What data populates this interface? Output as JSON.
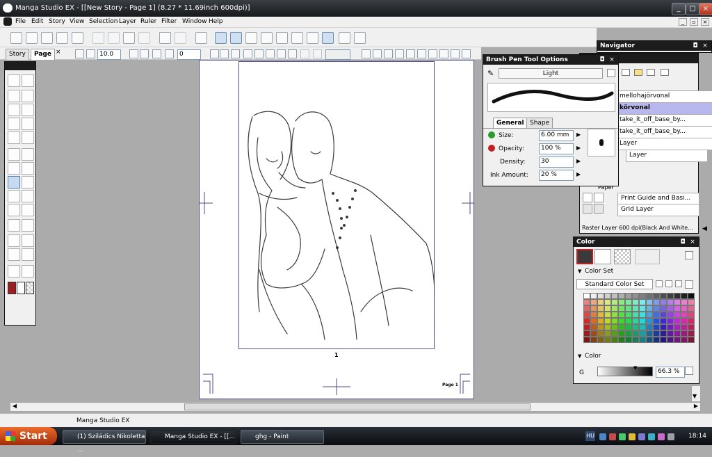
{
  "window": {
    "title": "Manga Studio EX - [[New Story - Page 1] (8.27 * 11.69inch 600dpi)]"
  },
  "menu": [
    "File",
    "Edit",
    "Story",
    "View",
    "Selection",
    "Layer",
    "Ruler",
    "Filter",
    "Window",
    "Help"
  ],
  "tabs": {
    "story": "Story",
    "page": "Page"
  },
  "toolbar2": {
    "value1": "10.0",
    "value2": "0"
  },
  "page": {
    "number": "1",
    "corner_label": "Page 1"
  },
  "navigator": {
    "title": "Navigator"
  },
  "brush": {
    "title": "Brush Pen Tool Options",
    "preset": "Light",
    "tab_general": "General",
    "tab_shape": "Shape",
    "size_label": "Size:",
    "size_value": "6.00 mm",
    "opacity_label": "Opacity:",
    "opacity_value": "100 %",
    "density_label": "Density:",
    "density_value": "30",
    "ink_label": "Ink Amount:",
    "ink_value": "20 %"
  },
  "layers": {
    "items": [
      "mellohajörvonal",
      "körvonal",
      "take_it_off_base_by...",
      "take_it_off_base_by...",
      "Layer",
      "Layer"
    ],
    "paper_label": "Paper",
    "paper_items": [
      "Print Guide and Basi...",
      "Grid Layer"
    ],
    "status": "Raster Layer 600 dpi(Black And White..."
  },
  "color": {
    "title": "Color",
    "colorset_label": "Color Set",
    "colorset_select": "Standard Color Set",
    "section_label": "Color",
    "channel": "G",
    "channel_value": "66.3 %"
  },
  "statusbar": {
    "text": "Manga Studio EX"
  },
  "taskbar": {
    "start": "Start",
    "tasks": [
      "(1) Sziládics Nikoletta ...",
      "Manga Studio EX - [[...",
      "ghg - Paint"
    ],
    "clock": "18:14",
    "lang": "HU"
  }
}
